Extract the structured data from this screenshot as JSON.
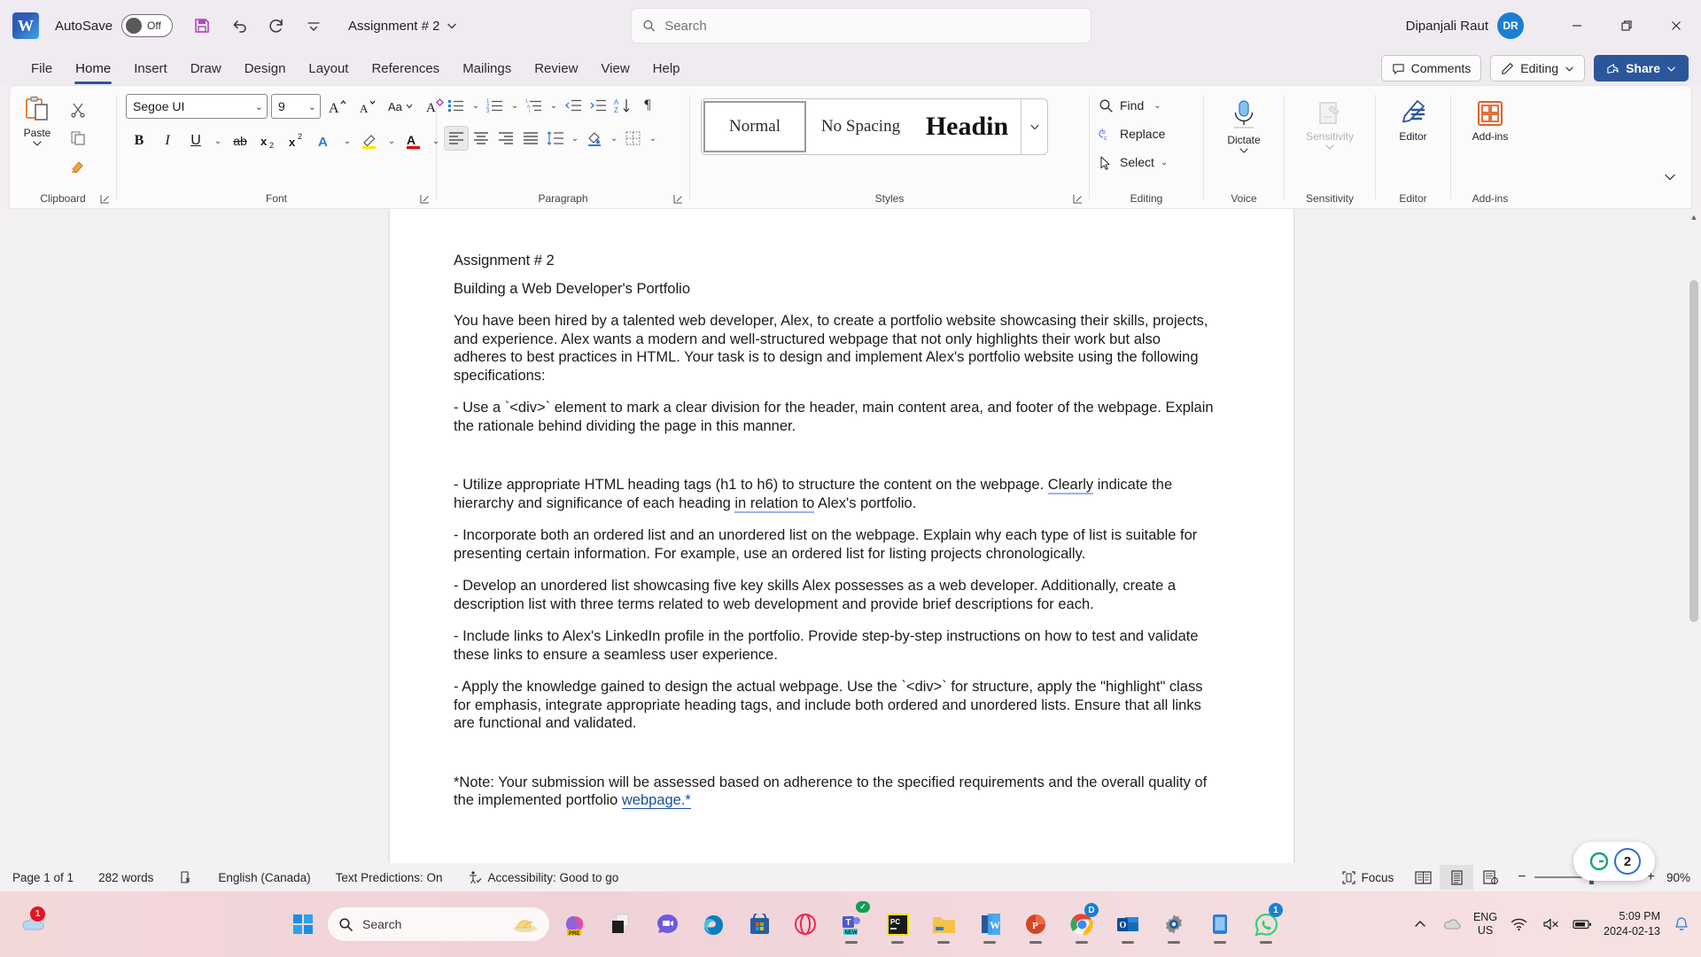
{
  "titlebar": {
    "app_icon": "word-logo",
    "autosave_label": "AutoSave",
    "autosave_state": "Off",
    "save_icon": "save-icon",
    "undo_icon": "undo-icon",
    "redo_icon": "redo-icon",
    "customize_icon": "customize-quick-access-icon",
    "document_title": "Assignment # 2",
    "search_placeholder": "Search",
    "search_value": "",
    "search_icon": "search-icon",
    "user_name": "Dipanjali Raut",
    "user_initials": "DR",
    "minimize_icon": "minimize-icon",
    "restore_icon": "restore-icon",
    "close_icon": "close-icon"
  },
  "ribbon_tabs": [
    {
      "label": "File",
      "active": false
    },
    {
      "label": "Home",
      "active": true
    },
    {
      "label": "Insert",
      "active": false
    },
    {
      "label": "Draw",
      "active": false
    },
    {
      "label": "Design",
      "active": false
    },
    {
      "label": "Layout",
      "active": false
    },
    {
      "label": "References",
      "active": false
    },
    {
      "label": "Mailings",
      "active": false
    },
    {
      "label": "Review",
      "active": false
    },
    {
      "label": "View",
      "active": false
    },
    {
      "label": "Help",
      "active": false
    }
  ],
  "tabs_right": {
    "comments_label": "Comments",
    "comments_icon": "comment-icon",
    "editing_label": "Editing",
    "editing_icon": "pencil-icon",
    "share_label": "Share",
    "share_icon": "share-icon"
  },
  "ribbon": {
    "clipboard": {
      "group_label": "Clipboard",
      "paste_label": "Paste",
      "paste_icon": "paste-icon",
      "cut_icon": "scissors-icon",
      "copy_icon": "copy-icon",
      "format_painter_icon": "format-painter-icon",
      "dialog_launcher_icon": "dialog-launcher-icon"
    },
    "font": {
      "group_label": "Font",
      "font_family_value": "Segoe UI",
      "font_size_value": "9",
      "grow_font_icon": "grow-font-icon",
      "shrink_font_icon": "shrink-font-icon",
      "change_case_icon": "change-case-icon",
      "clear_formatting_icon": "clear-formatting-icon",
      "bold_label": "B",
      "italic_label": "I",
      "underline_label": "U",
      "strikethrough_label": "ab",
      "subscript_label": "x",
      "superscript_label": "x",
      "text_effects_icon": "text-effects-icon",
      "highlight_icon": "text-highlight-icon",
      "font_color_icon": "font-color-icon",
      "dialog_launcher_icon": "dialog-launcher-icon"
    },
    "paragraph": {
      "group_label": "Paragraph",
      "bullets_icon": "bullets-icon",
      "numbering_icon": "numbering-icon",
      "multilevel_icon": "multilevel-list-icon",
      "decrease_indent_icon": "decrease-indent-icon",
      "increase_indent_icon": "increase-indent-icon",
      "sort_icon": "sort-icon",
      "show_marks_icon": "show-formatting-marks-icon",
      "align_left_icon": "align-left-icon",
      "align_center_icon": "align-center-icon",
      "align_right_icon": "align-right-icon",
      "justify_icon": "justify-icon",
      "line_spacing_icon": "line-spacing-icon",
      "shading_icon": "shading-icon",
      "borders_icon": "borders-icon",
      "dialog_launcher_icon": "dialog-launcher-icon"
    },
    "styles": {
      "group_label": "Styles",
      "items": [
        {
          "label": "Normal",
          "selected": true
        },
        {
          "label": "No Spacing",
          "selected": false
        },
        {
          "label": "Headin",
          "selected": false
        }
      ],
      "more_icon": "chevron-down-icon",
      "dialog_launcher_icon": "dialog-launcher-icon"
    },
    "editing": {
      "group_label": "Editing",
      "find_label": "Find",
      "find_icon": "search-icon",
      "replace_label": "Replace",
      "replace_icon": "replace-icon",
      "select_label": "Select",
      "select_icon": "cursor-icon"
    },
    "voice": {
      "group_label": "Voice",
      "dictate_label": "Dictate",
      "dictate_icon": "microphone-icon"
    },
    "sensitivity": {
      "group_label": "Sensitivity",
      "label": "Sensitivity",
      "icon": "sensitivity-icon",
      "disabled": true
    },
    "editor": {
      "group_label": "Editor",
      "label": "Editor",
      "icon": "editor-pen-icon"
    },
    "addins": {
      "group_label": "Add-ins",
      "label": "Add-ins",
      "icon": "addins-grid-icon"
    },
    "collapse_icon": "chevron-down-icon"
  },
  "document": {
    "paragraphs": [
      {
        "id": "p-title",
        "text": "Assignment # 2"
      },
      {
        "id": "p-subtitle",
        "text": "Building a Web Developer's Portfolio"
      },
      {
        "id": "p-intro",
        "text": "You have been hired by a talented web developer, Alex, to create a portfolio website showcasing their skills, projects, and experience. Alex wants a modern and well-structured webpage that not only highlights their work but also adheres to best practices in HTML. Your task is to design and implement Alex's portfolio website using the following specifications:"
      },
      {
        "id": "p-spec-1",
        "text": "   - Use a `<div>` element to mark a clear division for the header, main content area, and footer of the webpage. Explain the rationale behind dividing the page in this manner."
      },
      {
        "id": "p-spec-2a",
        "text": "   - Utilize appropriate HTML heading tags (h1 to h6) to structure the content on the webpage. "
      },
      {
        "id": "p-spec-2b",
        "text": "Clearly"
      },
      {
        "id": "p-spec-2c",
        "text": " indicate the hierarchy and significance of each heading "
      },
      {
        "id": "p-spec-2d",
        "text": "in relation to"
      },
      {
        "id": "p-spec-2e",
        "text": " Alex's portfolio."
      },
      {
        "id": "p-spec-3",
        "text": "   - Incorporate both an ordered list and an unordered list on the webpage. Explain why each type of list is suitable for presenting certain information. For example, use an ordered list for listing projects chronologically."
      },
      {
        "id": "p-spec-4",
        "text": "   - Develop an unordered list showcasing five key skills Alex possesses as a web developer. Additionally, create a description list with three terms related to web development and provide brief descriptions for each."
      },
      {
        "id": "p-spec-5",
        "text": "   - Include links to Alex's LinkedIn profile in the portfolio. Provide step-by-step instructions on how to test and validate these links to ensure a seamless user experience."
      },
      {
        "id": "p-spec-6",
        "text": "   - Apply the knowledge gained to design the actual webpage. Use the `<div>` for structure, apply the \"highlight\" class for emphasis, integrate appropriate heading tags, and include both ordered and unordered lists. Ensure that all links are functional and validated."
      },
      {
        "id": "p-note-a",
        "text": "*Note: Your submission will be assessed based on adherence to the specified requirements and the overall quality of the implemented portfolio "
      },
      {
        "id": "p-note-b",
        "text": "webpage.*"
      }
    ]
  },
  "statusbar": {
    "page_label": "Page 1 of 1",
    "word_count": "282 words",
    "proofing_icon": "proofing-errors-icon",
    "language": "English (Canada)",
    "text_predictions": "Text Predictions: On",
    "accessibility_icon": "accessibility-icon",
    "accessibility": "Accessibility: Good to go",
    "focus_label": "Focus",
    "focus_icon": "focus-icon",
    "read_mode_icon": "read-mode-icon",
    "print_layout_icon": "print-layout-icon",
    "web_layout_icon": "web-layout-icon",
    "zoom_out_label": "−",
    "zoom_in_label": "+",
    "zoom_level": "90%",
    "grammarly_icon": "grammarly-icon",
    "grammarly_count": "2"
  },
  "taskbar": {
    "onedrive_icon": "onedrive-icon",
    "onedrive_badge": "1",
    "start_icon": "windows-start-icon",
    "search_placeholder": "Search",
    "search_icon": "search-icon",
    "search_widget_icon": "food-widget-icon",
    "apps": [
      {
        "name": "copilot-pre-icon",
        "badge": ""
      },
      {
        "name": "files-stack-icon",
        "badge": ""
      },
      {
        "name": "zoom-icon",
        "badge": ""
      },
      {
        "name": "microsoft-edge-icon",
        "badge": ""
      },
      {
        "name": "microsoft-store-icon",
        "badge": ""
      },
      {
        "name": "opera-icon",
        "badge": ""
      },
      {
        "name": "microsoft-teams-new-icon",
        "badge": "check"
      },
      {
        "name": "pycharm-icon",
        "badge": ""
      },
      {
        "name": "file-explorer-icon",
        "badge": ""
      },
      {
        "name": "microsoft-word-icon",
        "badge": ""
      },
      {
        "name": "microsoft-powerpoint-icon",
        "badge": ""
      },
      {
        "name": "google-chrome-icon",
        "badge": "D"
      },
      {
        "name": "microsoft-outlook-icon",
        "badge": ""
      },
      {
        "name": "settings-gear-icon",
        "badge": ""
      },
      {
        "name": "phone-link-icon",
        "badge": ""
      },
      {
        "name": "whatsapp-icon",
        "badge": "1"
      }
    ],
    "tray": {
      "overflow_icon": "chevron-up-icon",
      "onedrive_icon": "onedrive-cloud-icon",
      "language": "ENG",
      "language_sub": "US",
      "wifi_icon": "wifi-icon",
      "volume_icon": "volume-muted-icon",
      "battery_icon": "battery-icon",
      "time": "5:09 PM",
      "date": "2024-02-13",
      "notification_icon": "bell-icon"
    }
  }
}
